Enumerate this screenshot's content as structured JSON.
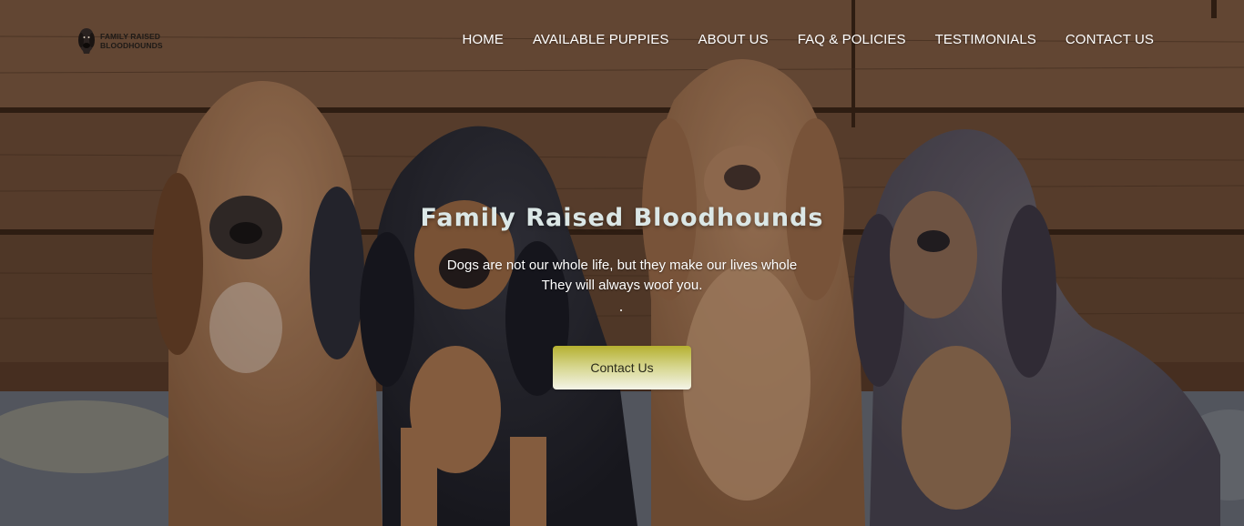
{
  "header": {
    "logo": {
      "line1": "FAMILY RAISED",
      "line2": "BLOODHOUNDS",
      "icon": "bloodhound-head-icon"
    },
    "nav": [
      {
        "label": "HOME"
      },
      {
        "label": "AVAILABLE PUPPIES"
      },
      {
        "label": "ABOUT US"
      },
      {
        "label": "FAQ & POLICIES"
      },
      {
        "label": "TESTIMONIALS"
      },
      {
        "label": "CONTACT US"
      }
    ]
  },
  "hero": {
    "title": "Family Raised Bloodhounds",
    "subtitle_line1": "Dogs are not our whole life, but they make our lives whole",
    "subtitle_line2": "They will always woof you.",
    "cta_label": "Contact Us",
    "background_image": "four bloodhound puppies sitting in front of a wooden plank wall"
  },
  "colors": {
    "title": "#dbe7e6",
    "nav_text": "#ffffff",
    "cta_gradient_top": "#b5b030",
    "cta_gradient_bottom": "#f4f4e8"
  }
}
